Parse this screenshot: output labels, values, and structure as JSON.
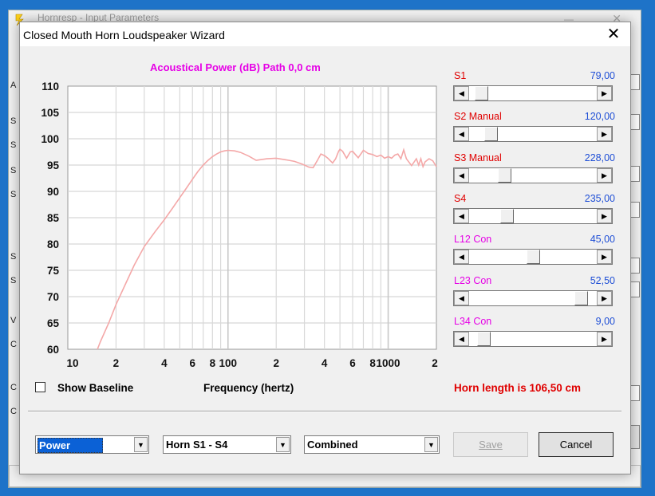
{
  "background_window": {
    "title": "Hornresp - Input Parameters",
    "side_letters": [
      "A",
      "S",
      "S",
      "S",
      "S",
      "S",
      "S",
      "V",
      "C",
      "C",
      "C"
    ]
  },
  "dialog": {
    "title": "Closed Mouth Horn Loudspeaker Wizard"
  },
  "chart_data": {
    "type": "line",
    "title": "Acoustical Power (dB)   Path 0,0 cm",
    "xlabel": "Frequency (hertz)",
    "ylabel": "",
    "x_scale": "log",
    "xlim": [
      10,
      2000
    ],
    "ylim": [
      60,
      110
    ],
    "y_ticks": [
      "110",
      "105",
      "100",
      "95",
      "90",
      "85",
      "80",
      "75",
      "70",
      "65",
      "60"
    ],
    "x_ticks": [
      "10",
      "2",
      "4",
      "6",
      "8",
      "100",
      "2",
      "4",
      "6",
      "8",
      "1000",
      "2"
    ],
    "grid": true,
    "line_color": "#f4a8a8",
    "series": [
      {
        "x": [
          15.3,
          16,
          18,
          20,
          23,
          26,
          30,
          35,
          40,
          45,
          50,
          55,
          60,
          65,
          70,
          75,
          80,
          85,
          90,
          95,
          100,
          110,
          120,
          135,
          150,
          175,
          200,
          230,
          260,
          290,
          320,
          340,
          360,
          380,
          400,
          420,
          450,
          470,
          490,
          500,
          520,
          550,
          580,
          600,
          650,
          700,
          750,
          800,
          850,
          900,
          950,
          1000,
          1050,
          1100,
          1150,
          1200,
          1250,
          1300,
          1400,
          1500,
          1550,
          1600,
          1650,
          1700,
          1800,
          1900,
          2000
        ],
        "values": [
          60,
          61.5,
          65,
          68.5,
          72.5,
          76,
          79.5,
          82.3,
          84.6,
          86.8,
          88.8,
          90.6,
          92.3,
          93.8,
          95,
          95.9,
          96.6,
          97.1,
          97.5,
          97.7,
          97.8,
          97.7,
          97.4,
          96.7,
          95.9,
          96.2,
          96.3,
          96.0,
          95.7,
          95.2,
          94.6,
          94.5,
          95.8,
          97.1,
          96.8,
          96.3,
          95.4,
          96.2,
          97.6,
          98.0,
          97.6,
          96.3,
          97.5,
          97.6,
          96.4,
          97.8,
          97.2,
          97.0,
          96.6,
          96.9,
          96.3,
          96.6,
          96.3,
          96.9,
          97.1,
          96.2,
          97.9,
          96.2,
          94.9,
          96.2,
          95.0,
          96.2,
          94.7,
          95.6,
          96.2,
          95.8,
          94.7
        ]
      }
    ]
  },
  "show_baseline_label": "Show Baseline",
  "horn_length": "Horn length is 106,50 cm",
  "sliders": [
    {
      "label": "S1",
      "value": "79,00",
      "color": "#e00000",
      "pos": 0.05
    },
    {
      "label": "S2  Manual",
      "value": "120,00",
      "color": "#e00000",
      "pos": 0.13
    },
    {
      "label": "S3  Manual",
      "value": "228,00",
      "color": "#e00000",
      "pos": 0.25
    },
    {
      "label": "S4",
      "value": "235,00",
      "color": "#e00000",
      "pos": 0.27
    },
    {
      "label": "L12  Con",
      "value": "45,00",
      "color": "#e600e6",
      "pos": 0.5
    },
    {
      "label": "L23  Con",
      "value": "52,50",
      "color": "#e600e6",
      "pos": 0.92
    },
    {
      "label": "L34  Con",
      "value": "9,00",
      "color": "#e600e6",
      "pos": 0.07
    }
  ],
  "combos": {
    "type": "Power",
    "horn": "Horn S1 - S4",
    "mode": "Combined"
  },
  "buttons": {
    "save": "Save",
    "cancel": "Cancel"
  },
  "colors": {
    "title_magenta": "#e600e6",
    "red": "#e00000",
    "value_blue": "#1f4fd6"
  }
}
